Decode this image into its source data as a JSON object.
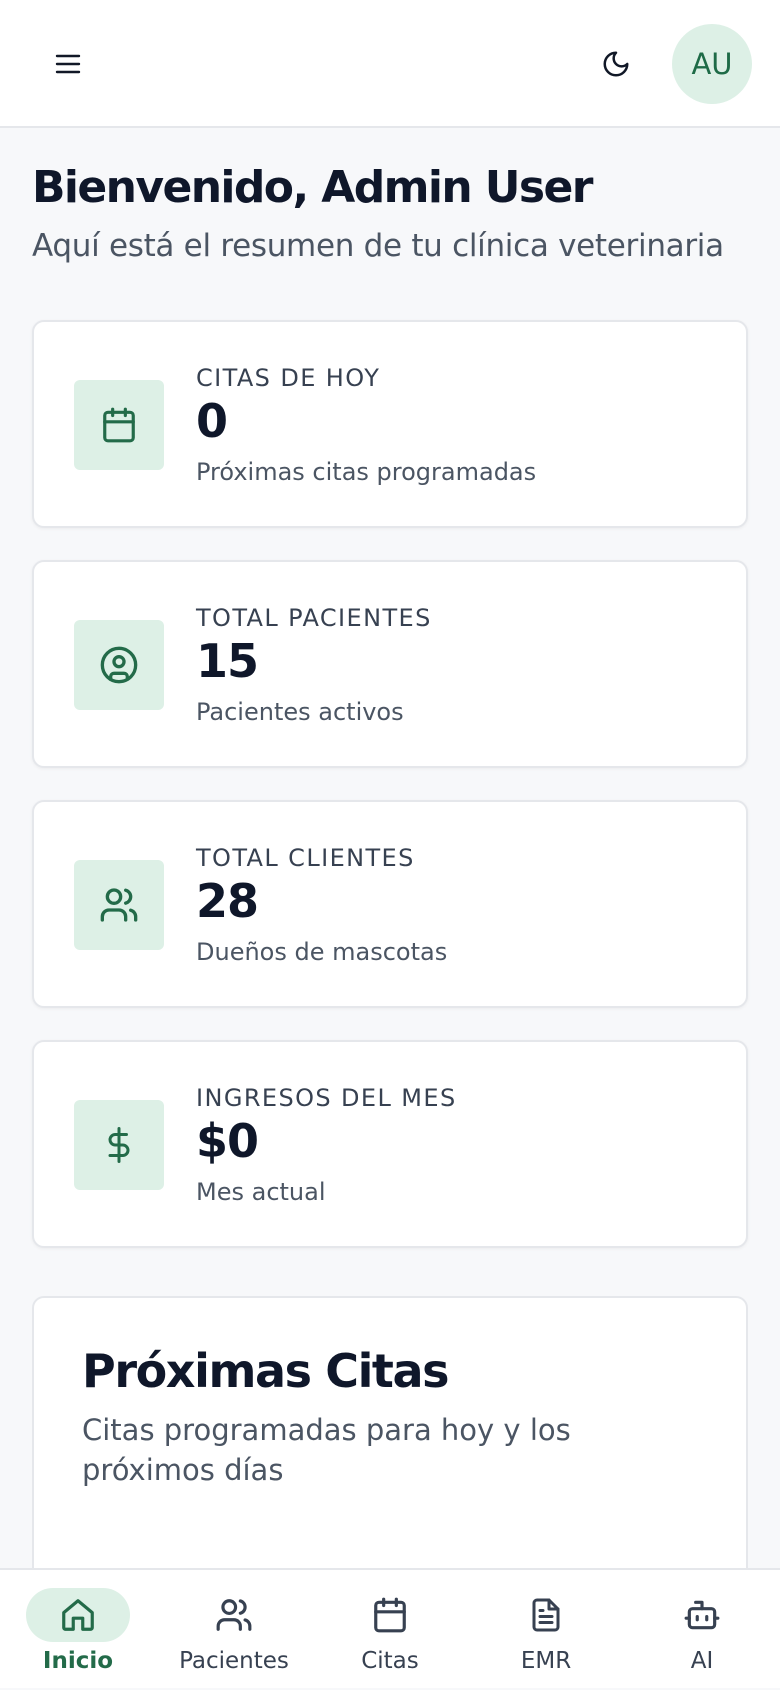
{
  "header": {
    "menu_icon": "menu-icon",
    "theme_icon": "moon-icon",
    "avatar_initials": "AU"
  },
  "welcome": {
    "title": "Bienvenido, Admin User",
    "subtitle": "Aquí está el resumen de tu clínica veterinaria"
  },
  "stats": [
    {
      "icon": "calendar-icon",
      "label": "CITAS DE HOY",
      "value": "0",
      "description": "Próximas citas programadas"
    },
    {
      "icon": "user-circle-icon",
      "label": "TOTAL PACIENTES",
      "value": "15",
      "description": "Pacientes activos"
    },
    {
      "icon": "users-icon",
      "label": "TOTAL CLIENTES",
      "value": "28",
      "description": "Dueños de mascotas"
    },
    {
      "icon": "dollar-icon",
      "label": "INGRESOS DEL MES",
      "value": "$0",
      "description": "Mes actual"
    }
  ],
  "upcoming": {
    "title": "Próximas Citas",
    "description": "Citas programadas para hoy y los próximos días"
  },
  "bottom_nav": {
    "items": [
      {
        "label": "Inicio",
        "icon": "home-icon",
        "active": true
      },
      {
        "label": "Pacientes",
        "icon": "users-icon",
        "active": false
      },
      {
        "label": "Citas",
        "icon": "calendar-icon",
        "active": false
      },
      {
        "label": "EMR",
        "icon": "document-icon",
        "active": false
      },
      {
        "label": "AI",
        "icon": "bot-icon",
        "active": false
      }
    ]
  },
  "colors": {
    "accent": "#236b49",
    "accent_soft": "#ddf0e6",
    "background": "#f7f8fa",
    "text_primary": "#0f172a",
    "text_secondary": "#4b5563"
  }
}
